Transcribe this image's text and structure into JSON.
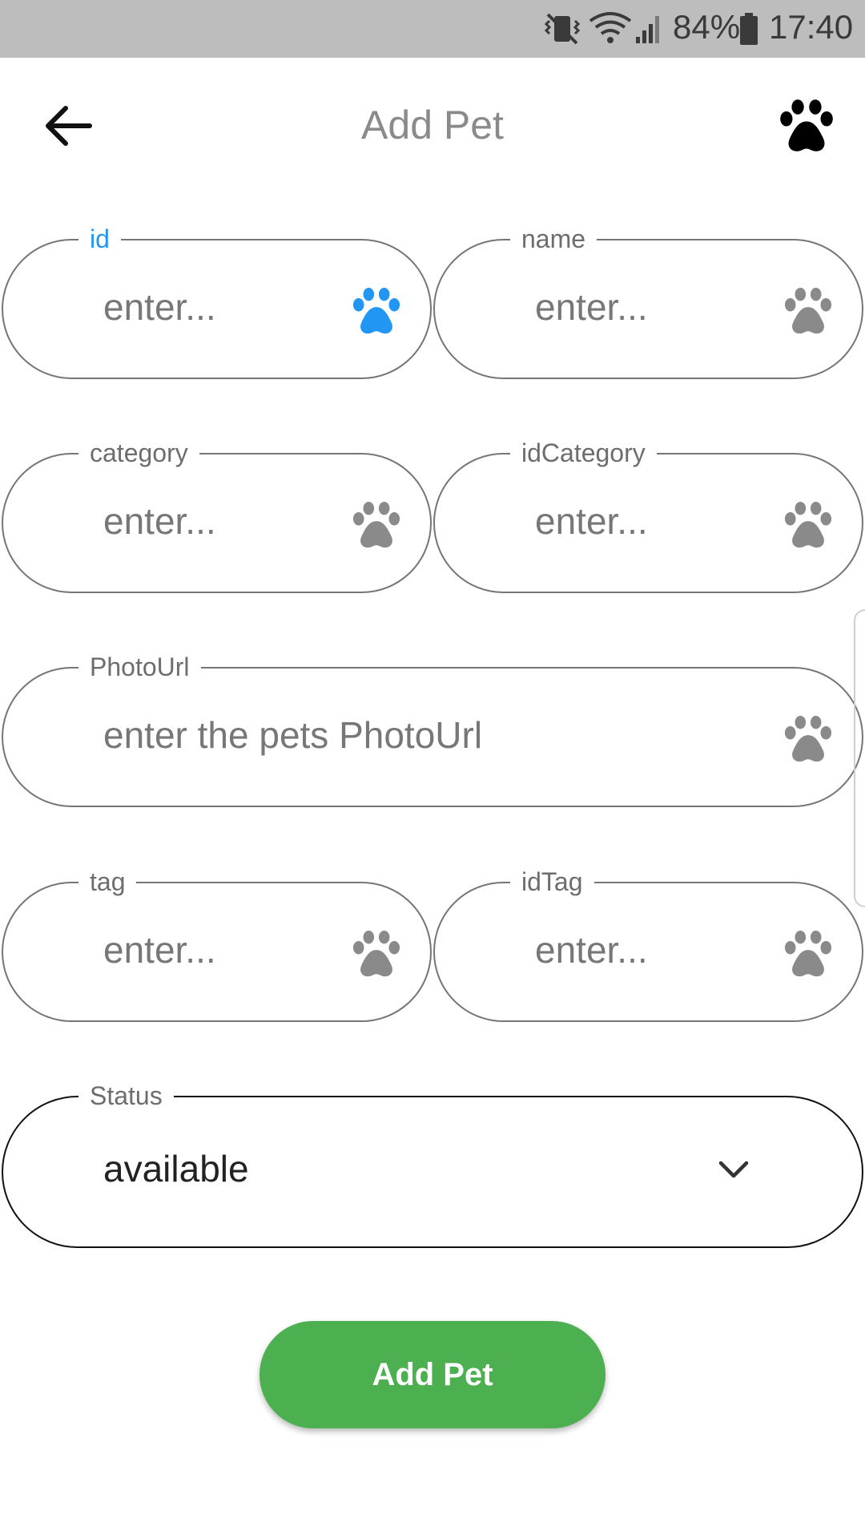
{
  "status_bar": {
    "battery": "84%",
    "time": "17:40",
    "icons": [
      "vibrate-icon",
      "wifi-icon",
      "signal-icon",
      "battery-icon"
    ]
  },
  "app_bar": {
    "title": "Add Pet",
    "back_icon": "arrow-left-icon",
    "action_icon": "paw-icon"
  },
  "colors": {
    "status_bar_bg": "#bdbdbd",
    "focused": "#2196f3",
    "icon_grey": "#8a8a8a",
    "border": "#757575",
    "button": "#4caf50"
  },
  "form": {
    "id": {
      "label": "id",
      "placeholder": "enter...",
      "icon": "paw-icon",
      "focused": true
    },
    "name": {
      "label": "name",
      "placeholder": "enter...",
      "icon": "paw-icon"
    },
    "category": {
      "label": "category",
      "placeholder": "enter...",
      "icon": "paw-icon"
    },
    "idCategory": {
      "label": "idCategory",
      "placeholder": "enter...",
      "icon": "paw-icon"
    },
    "photoUrl": {
      "label": "PhotoUrl",
      "placeholder": "enter the pets PhotoUrl",
      "icon": "paw-icon"
    },
    "tag": {
      "label": "tag",
      "placeholder": "enter...",
      "icon": "paw-icon"
    },
    "idTag": {
      "label": "idTag",
      "placeholder": "enter...",
      "icon": "paw-icon"
    },
    "status": {
      "label": "Status",
      "value": "available",
      "icon": "chevron-down-icon"
    }
  },
  "submit_button": {
    "label": "Add Pet"
  }
}
